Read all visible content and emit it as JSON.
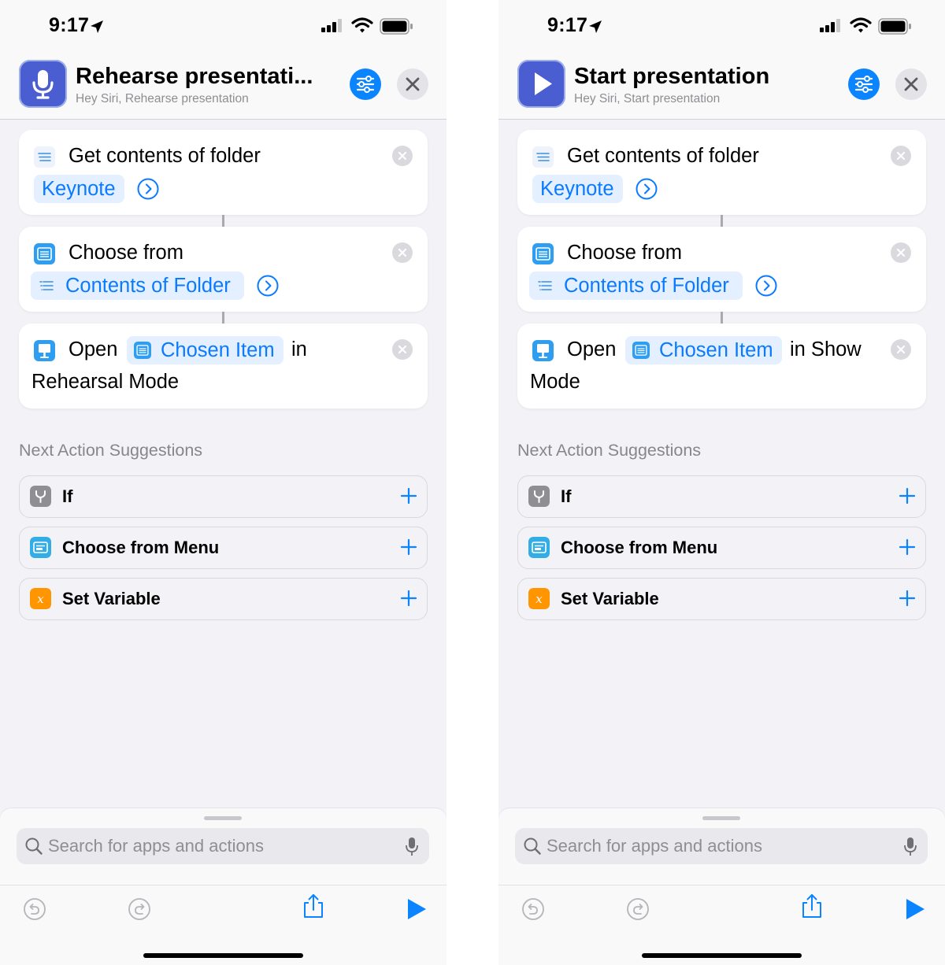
{
  "status_bar": {
    "time": "9:17"
  },
  "screens": [
    {
      "title": "Rehearse presentati...",
      "subtitle": "Hey Siri, Rehearse presentation",
      "icon": "microphone-icon",
      "actions": {
        "get_folder": {
          "label": "Get contents of folder",
          "token": "Keynote"
        },
        "choose_from": {
          "label": "Choose from",
          "token": "Contents of Folder"
        },
        "open": {
          "label": "Open",
          "token": "Chosen Item",
          "suffix": "in",
          "line2": "Rehearsal Mode"
        }
      }
    },
    {
      "title": "Start presentation",
      "subtitle": "Hey Siri, Start presentation",
      "icon": "play-icon",
      "actions": {
        "get_folder": {
          "label": "Get contents of folder",
          "token": "Keynote"
        },
        "choose_from": {
          "label": "Choose from",
          "token": "Contents of Folder"
        },
        "open": {
          "label": "Open",
          "token": "Chosen Item",
          "suffix": "in Show",
          "line2": "Mode"
        }
      }
    }
  ],
  "suggestions": {
    "title": "Next Action Suggestions",
    "items": [
      {
        "label": "If",
        "icon": "if-icon",
        "color": "#8e8e93"
      },
      {
        "label": "Choose from Menu",
        "icon": "menu-icon",
        "color": "#32ade6"
      },
      {
        "label": "Set Variable",
        "icon": "variable-icon",
        "color": "#ff9500"
      }
    ]
  },
  "search": {
    "placeholder": "Search for apps and actions"
  },
  "colors": {
    "accent": "#0a84ff",
    "token_bg": "#e4efff",
    "background": "#f2f2f7"
  }
}
